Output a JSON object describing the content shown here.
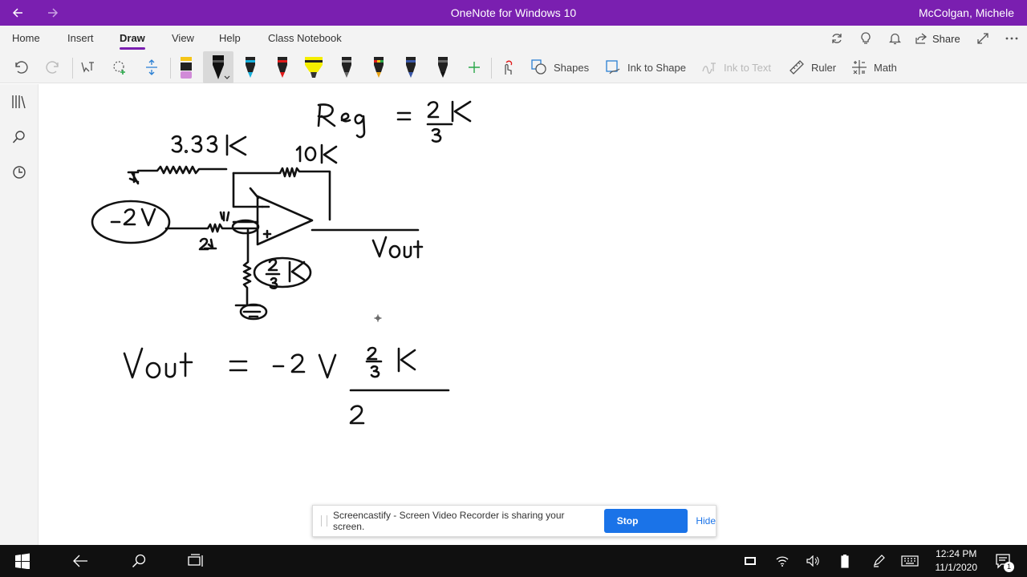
{
  "titlebar": {
    "title": "OneNote for Windows 10",
    "user": "McColgan, Michele",
    "back_icon": "back-arrow-icon",
    "forward_icon": "forward-arrow-icon"
  },
  "tabs": [
    "Home",
    "Insert",
    "Draw",
    "View",
    "Help",
    "Class Notebook"
  ],
  "active_tab": "Draw",
  "tab_actions": {
    "share_label": "Share"
  },
  "toolbar": {
    "shapes_label": "Shapes",
    "ink_to_shape_label": "Ink to Shape",
    "ink_to_text_label": "Ink to Text",
    "ruler_label": "Ruler",
    "math_label": "Math",
    "pens": [
      {
        "name": "pink-highlighter",
        "color": "#d18bd8"
      },
      {
        "name": "black-pen",
        "color": "#111111"
      },
      {
        "name": "cyan-pen",
        "color": "#17b0dc"
      },
      {
        "name": "red-pen",
        "color": "#e01a1a"
      },
      {
        "name": "yellow-highlighter",
        "color": "#f5ee00"
      },
      {
        "name": "galaxy-pen",
        "color": "#666666"
      },
      {
        "name": "rainbow-pen",
        "color": "#e8a317"
      },
      {
        "name": "ocean-pen",
        "color": "#3a57a8"
      },
      {
        "name": "black-pen-2",
        "color": "#111111"
      }
    ],
    "accent_color": "#7a1fb0"
  },
  "sharing_banner": {
    "message": "Screencastify - Screen Video Recorder is sharing your screen.",
    "stop_label": "Stop sharing",
    "hide_label": "Hide"
  },
  "taskbar": {
    "time": "12:24 PM",
    "date": "11/1/2020",
    "notification_count": "1"
  }
}
